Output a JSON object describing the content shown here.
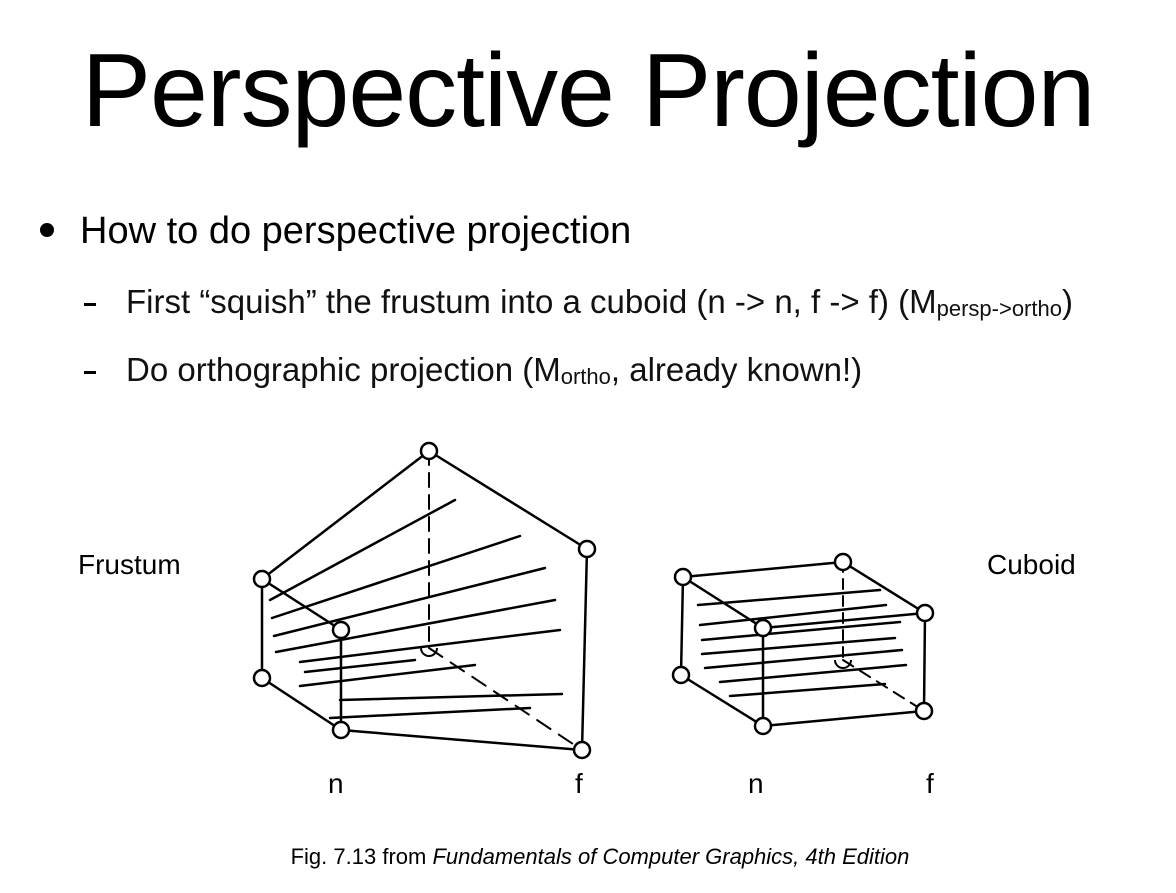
{
  "slide": {
    "title": "Perspective Projection",
    "bullet": "How to do perspective projection",
    "sub1": {
      "text": "First “squish” the frustum into a cuboid (n -> n, f -> f) (M",
      "subscript": "persp->ortho",
      "close": ")"
    },
    "sub2": {
      "text": "Do orthographic projection (M",
      "subscript": "ortho",
      "rest": ", already known!)"
    }
  },
  "figure": {
    "frustum_label": "Frustum",
    "cuboid_label": "Cuboid",
    "frustum_near": "n",
    "frustum_far": "f",
    "cuboid_near": "n",
    "cuboid_far": "f",
    "caption_prefix": "Fig. 7.13 from ",
    "caption_book": "Fundamentals of Computer Graphics, 4th Edition"
  }
}
